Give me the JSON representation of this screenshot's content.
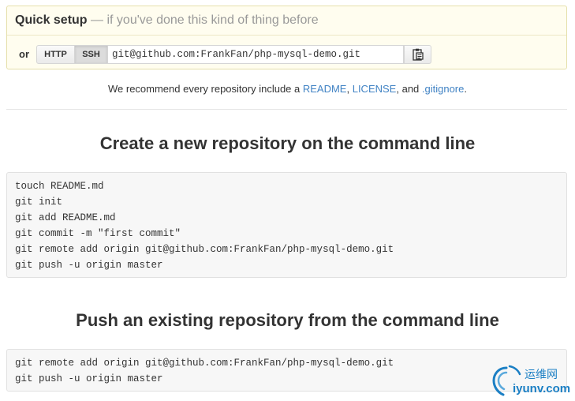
{
  "quick_setup": {
    "title": "Quick setup",
    "subtitle": " — if you've done this kind of thing before",
    "or_label": "or",
    "http_label": "HTTP",
    "ssh_label": "SSH",
    "clone_url": "git@github.com:FrankFan/php-mysql-demo.git",
    "copy_icon": "clipboard-icon"
  },
  "recommend": {
    "prefix": "We recommend every repository include a ",
    "readme": "README",
    "sep1": ", ",
    "license": "LICENSE",
    "sep2": ", and ",
    "gitignore": ".gitignore",
    "suffix": "."
  },
  "new_repo": {
    "heading": "Create a new repository on the command line",
    "lines": [
      "touch README.md",
      "git init",
      "git add README.md",
      "git commit -m \"first commit\"",
      "git remote add origin git@github.com:FrankFan/php-mysql-demo.git",
      "git push -u origin master"
    ]
  },
  "existing_repo": {
    "heading": "Push an existing repository from the command line",
    "lines": [
      "git remote add origin git@github.com:FrankFan/php-mysql-demo.git",
      "git push -u origin master"
    ]
  },
  "watermark": {
    "cn": "运维网",
    "en": "iyunv.com"
  },
  "colors": {
    "link": "#4183c4",
    "quick_setup_bg": "#fffdef",
    "watermark": "#1b7fc4"
  }
}
